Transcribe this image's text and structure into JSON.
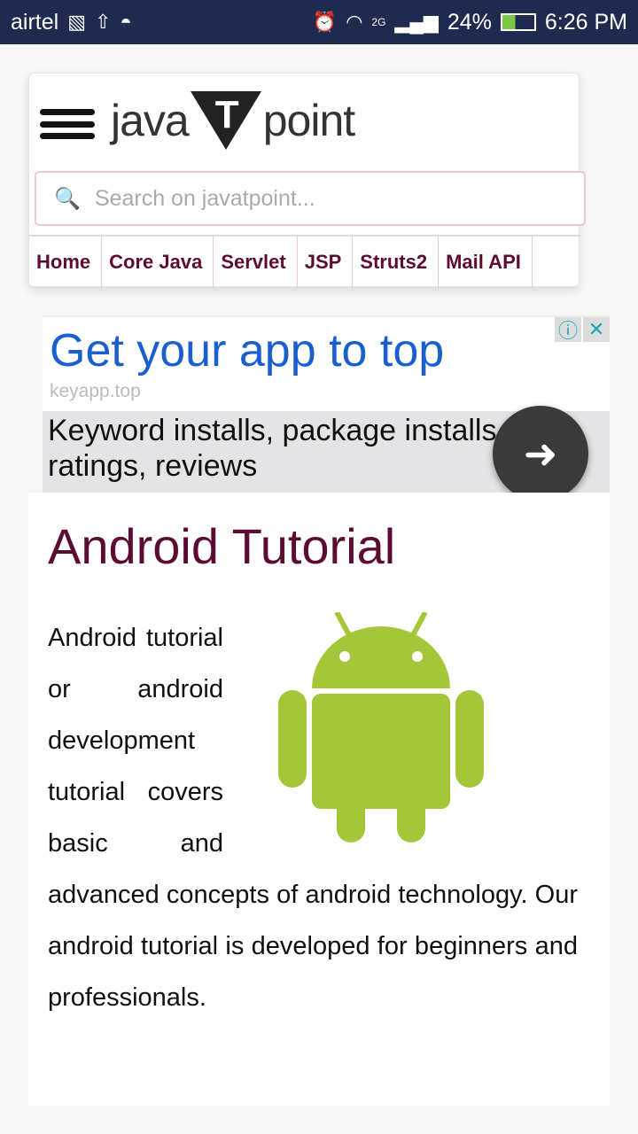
{
  "status": {
    "carrier": "airtel",
    "network": "2G",
    "battery": "24%",
    "time": "6:26 PM"
  },
  "header": {
    "logo": {
      "java": "java",
      "t": "T",
      "point": "point"
    },
    "search_placeholder": "Search on javatpoint...",
    "nav": [
      "Home",
      "Core Java",
      "Servlet",
      "JSP",
      "Struts2",
      "Mail API"
    ]
  },
  "ad": {
    "headline": "Get your app to top",
    "domain": "keyapp.top",
    "description": "Keyword installs, package installs, ratings, reviews"
  },
  "article": {
    "title": "Android Tutorial",
    "body": "Android tutorial or android development tutorial covers basic and advanced concepts of android technology. Our android tutorial is developed for beginners and professionals."
  },
  "colors": {
    "status_bar": "#1e2a4e",
    "nav_text": "#5c0b32",
    "ad_headline": "#1a5fcf",
    "android_green": "#a4c639"
  }
}
